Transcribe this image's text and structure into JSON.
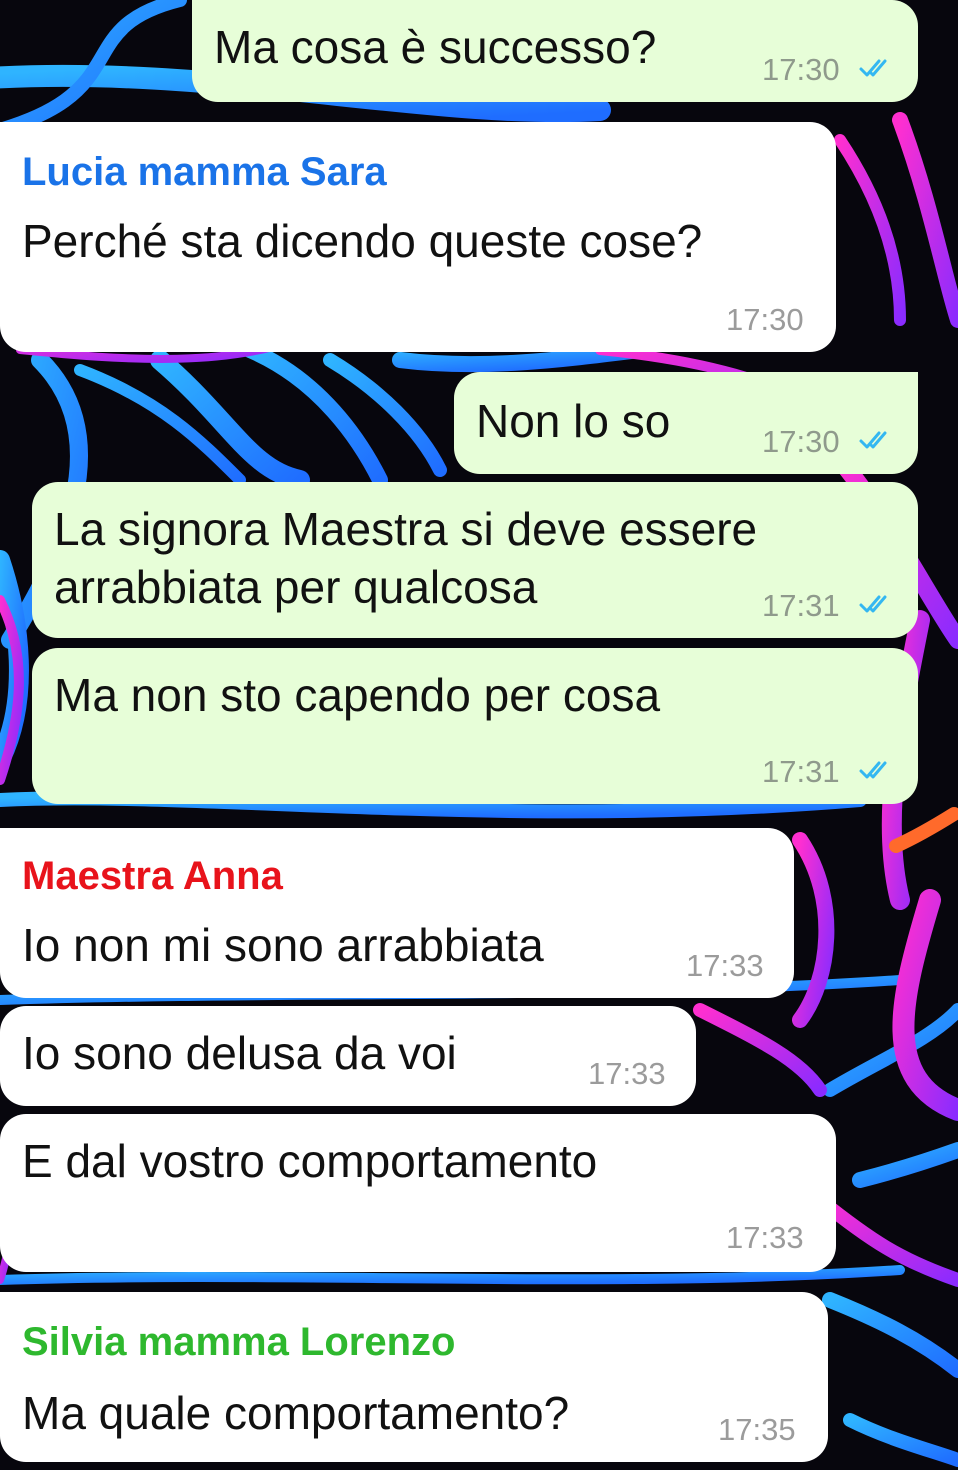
{
  "chat": {
    "sender_colors": {
      "lucia": "#1a73e8",
      "anna": "#e8131b",
      "silvia": "#2eb82e"
    },
    "colors": {
      "outgoing_bubble": "#e7fed8",
      "incoming_bubble": "#ffffff",
      "read_ticks": "#34b7f1"
    },
    "messages": [
      {
        "text": "Ma cosa è successo?",
        "time": "17:30",
        "status_icon": "double-check-read-icon"
      },
      {
        "sender": "Lucia mamma Sara",
        "text": "Perché sta dicendo queste cose?",
        "time": "17:30"
      },
      {
        "text": "Non lo so",
        "time": "17:30",
        "status_icon": "double-check-read-icon"
      },
      {
        "text_line1": "La signora Maestra si deve essere",
        "text_line2": "arrabbiata per qualcosa",
        "time": "17:31",
        "status_icon": "double-check-read-icon"
      },
      {
        "text": "Ma non sto capendo per cosa",
        "time": "17:31",
        "status_icon": "double-check-read-icon"
      },
      {
        "sender": "Maestra Anna",
        "text": "Io non mi sono arrabbiata",
        "time": "17:33"
      },
      {
        "text": "Io sono delusa da voi",
        "time": "17:33"
      },
      {
        "text": "E dal vostro comportamento",
        "time": "17:33"
      },
      {
        "sender": "Silvia mamma Lorenzo",
        "text": "Ma quale comportamento?",
        "time": "17:35"
      }
    ]
  }
}
